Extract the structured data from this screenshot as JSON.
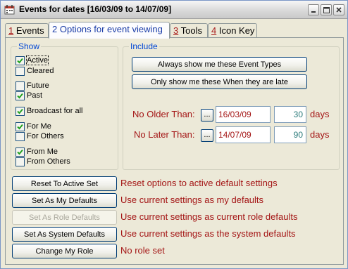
{
  "window": {
    "title": "Events for dates [16/03/09 to 14/07/09]"
  },
  "tabs": [
    {
      "num": "1",
      "label": " Events"
    },
    {
      "num": "2",
      "label": " Options for event viewing"
    },
    {
      "num": "3",
      "label": " Tools"
    },
    {
      "num": "4",
      "label": " Icon Key"
    }
  ],
  "show": {
    "title": "Show",
    "items": [
      {
        "label": "Active",
        "checked": true
      },
      {
        "label": "Cleared",
        "checked": false
      },
      {
        "label": "Future",
        "checked": false
      },
      {
        "label": "Past",
        "checked": true
      },
      {
        "label": "Broadcast for all",
        "checked": true
      },
      {
        "label": "For Me",
        "checked": true
      },
      {
        "label": "For Others",
        "checked": false
      },
      {
        "label": "From Me",
        "checked": true
      },
      {
        "label": "From Others",
        "checked": false
      }
    ]
  },
  "include": {
    "title": "Include",
    "btn_always": "Always show me these Event Types",
    "btn_late": "Only show me these When they are late",
    "no_older_label": "No Older Than:",
    "no_later_label": "No Later Than:",
    "ellipsis": "...",
    "no_older_date": "16/03/09",
    "no_later_date": "14/07/09",
    "no_older_days": "30",
    "no_later_days": "90",
    "days_label": "days"
  },
  "actions": [
    {
      "button": "Reset To Active Set",
      "desc": "Reset options to active default settings",
      "enabled": true
    },
    {
      "button": "Set As My Defaults",
      "desc": "Use current settings as my defaults",
      "enabled": true
    },
    {
      "button": "Set As Role Defaults",
      "desc": "Use current settings as current role defaults",
      "enabled": false
    },
    {
      "button": "Set As System Defaults",
      "desc": "Use current settings as the system defaults",
      "enabled": true
    },
    {
      "button": "Change My Role",
      "desc": "No role set",
      "enabled": true
    }
  ],
  "colors": {
    "accent_red": "#a41616",
    "group_title_blue": "#0046d5",
    "number_teal": "#2a7a7a"
  }
}
